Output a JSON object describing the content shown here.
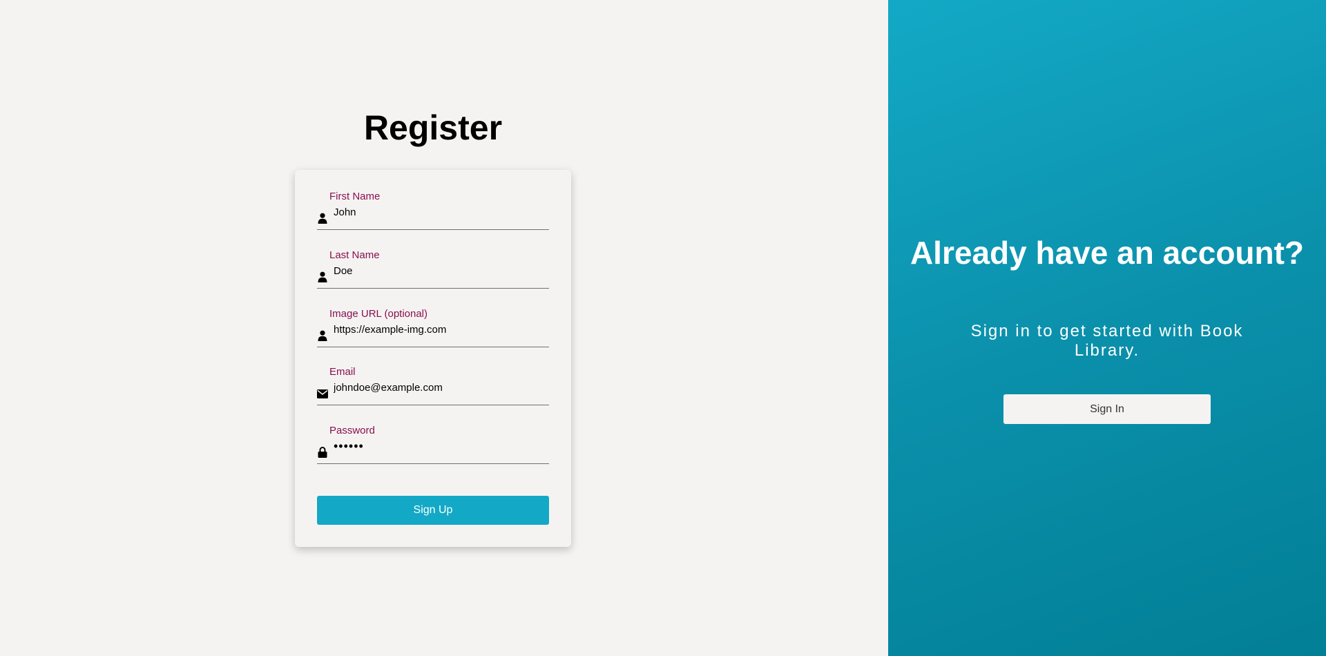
{
  "register": {
    "title": "Register",
    "fields": [
      {
        "label": "First Name",
        "value": "John",
        "icon": "person-icon"
      },
      {
        "label": "Last Name",
        "value": "Doe",
        "icon": "person-icon"
      },
      {
        "label": "Image URL (optional)",
        "value": "https://example-img.com",
        "icon": "person-icon"
      },
      {
        "label": "Email",
        "value": "johndoe@example.com",
        "icon": "envelope-icon"
      },
      {
        "label": "Password",
        "value": "••••••",
        "icon": "lock-icon"
      }
    ],
    "submit_label": "Sign Up"
  },
  "signin_panel": {
    "title": "Already have an account?",
    "subtitle": "Sign in to get started with Book Library.",
    "button_label": "Sign In"
  },
  "colors": {
    "accent": "#13a9c6",
    "label": "#87104f",
    "background": "#f5f3f2"
  }
}
